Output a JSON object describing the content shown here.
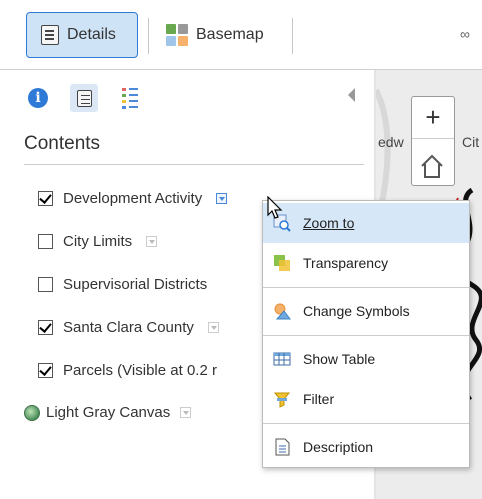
{
  "toolbar": {
    "details_label": "Details",
    "basemap_label": "Basemap",
    "share_glyph": "∞"
  },
  "panel": {
    "title": "Contents",
    "tabs": [
      {
        "name": "about",
        "icon": "info-icon"
      },
      {
        "name": "content",
        "icon": "list-doc-icon",
        "selected": true
      },
      {
        "name": "legend",
        "icon": "legend-icon"
      }
    ]
  },
  "layers": [
    {
      "label": "Development Activity",
      "checked": true
    },
    {
      "label": "City Limits",
      "checked": false
    },
    {
      "label": "Supervisorial Districts",
      "checked": false
    },
    {
      "label": "Santa Clara County",
      "checked": true
    },
    {
      "label": "Parcels (Visible at 0.2 r",
      "checked": true
    }
  ],
  "basemap_layer": {
    "label": "Light Gray Canvas",
    "icon": "globe-icon"
  },
  "map": {
    "label_left": "edw",
    "label_right": "Cit",
    "zoom_in_glyph": "+"
  },
  "context_menu": {
    "items": [
      {
        "label": "Zoom to",
        "icon": "zoom-to-icon",
        "highlighted": true
      },
      {
        "label": "Transparency",
        "icon": "transparency-icon"
      },
      {
        "label": "Change Symbols",
        "icon": "change-symbols-icon"
      },
      {
        "label": "Show Table",
        "icon": "table-icon"
      },
      {
        "label": "Filter",
        "icon": "filter-icon"
      },
      {
        "label": "Description",
        "icon": "description-icon"
      }
    ]
  },
  "colors": {
    "accent": "#2f7ad6",
    "selected_bg": "#cfe3f7",
    "menu_highlight": "#d6e8f8"
  }
}
